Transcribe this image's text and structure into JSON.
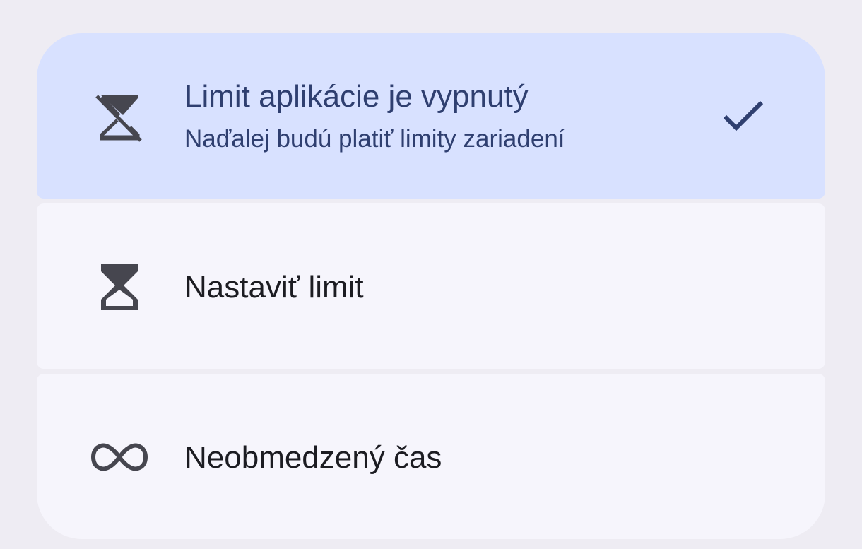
{
  "options": [
    {
      "title": "Limit aplikácie je vypnutý",
      "subtitle": "Naďalej budú platiť limity zariadení",
      "icon": "hourglass-disabled-icon",
      "selected": true
    },
    {
      "title": "Nastaviť limit",
      "icon": "hourglass-icon",
      "selected": false
    },
    {
      "title": "Neobmedzený čas",
      "icon": "infinity-icon",
      "selected": false
    }
  ],
  "colors": {
    "background": "#eeecf3",
    "selected_background": "#d8e1ff",
    "item_background": "#f6f5fc",
    "accent": "#2f3f70",
    "icon": "#46464f"
  }
}
